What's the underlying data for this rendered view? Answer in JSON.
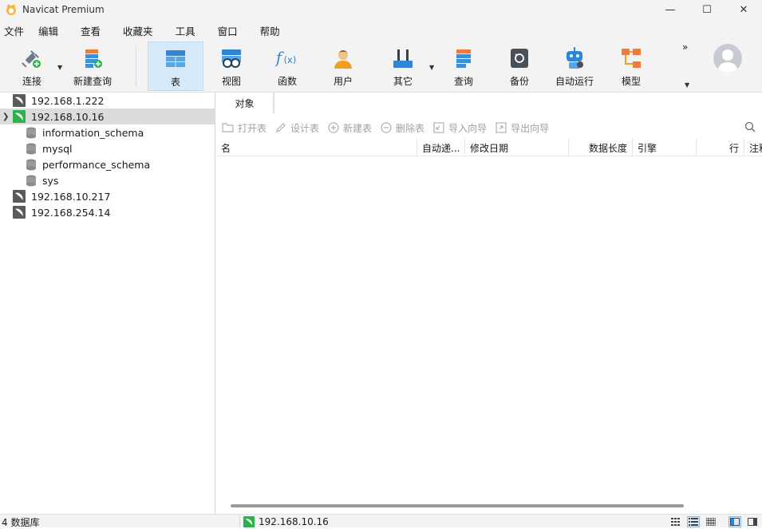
{
  "window": {
    "title": "Navicat Premium",
    "minimize": "—",
    "maximize": "☐",
    "close": "✕"
  },
  "menu": [
    "文件",
    "编辑",
    "查看",
    "收藏夹",
    "工具",
    "窗口",
    "帮助"
  ],
  "toolbar": {
    "connect": "连接",
    "new_query": "新建查询",
    "table": "表",
    "view": "视图",
    "function": "函数",
    "user": "用户",
    "other": "其它",
    "query": "查询",
    "backup": "备份",
    "automation": "自动运行",
    "model": "模型",
    "more": "»"
  },
  "tree": {
    "connections": [
      {
        "name": "192.168.1.222"
      },
      {
        "name": "192.168.10.16"
      },
      {
        "name": "192.168.10.217"
      },
      {
        "name": "192.168.254.14"
      }
    ],
    "databases": [
      "information_schema",
      "mysql",
      "performance_schema",
      "sys"
    ]
  },
  "tabs": {
    "objects": "对象"
  },
  "object_toolbar": {
    "open_table": "打开表",
    "design_table": "设计表",
    "new_table": "新建表",
    "delete_table": "删除表",
    "import_wizard": "导入向导",
    "export_wizard": "导出向导"
  },
  "grid": {
    "columns": [
      "名",
      "自动递...",
      "修改日期",
      "数据长度",
      "引擎",
      "行",
      "注释"
    ]
  },
  "status": {
    "db_count": "4 数据库",
    "connection": "192.168.10.16"
  },
  "colors": {
    "accent": "#d6e9f8",
    "toolbar_bg": "#f3f3f3",
    "server_green": "#2bb24c",
    "server_gray": "#5a5a5a"
  }
}
